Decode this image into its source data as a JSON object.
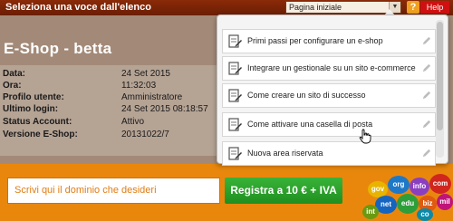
{
  "topbar": {
    "title": "Seleziona una voce dall'elenco",
    "page_select_value": "Pagina iniziale",
    "help_q": "?",
    "help_label": "Help"
  },
  "shop": {
    "title": "E-Shop - betta"
  },
  "info": {
    "rows": [
      {
        "label": "Data:",
        "value": "24 Set 2015"
      },
      {
        "label": "Ora:",
        "value": "11:32:03"
      },
      {
        "label": "Profilo utente:",
        "value": "Amministratore"
      },
      {
        "label": "Ultimo login:",
        "value": "24 Set 2015 08:18:57"
      },
      {
        "label": "Status Account:",
        "value": "Attivo"
      },
      {
        "label": "Versione E-Shop:",
        "value": "20131022/7"
      }
    ]
  },
  "domain": {
    "placeholder": "Scrivi qui il dominio che desideri",
    "register_label": "Registra a 10 € + IVA",
    "tlds": [
      "gov",
      "org",
      "info",
      "com",
      "net",
      "edu",
      "biz",
      "mil",
      "int",
      "co"
    ]
  },
  "menu": {
    "items": [
      {
        "label": "Primi passi per configurare un e-shop"
      },
      {
        "label": "Integrare un gestionale su un sito e-commerce"
      },
      {
        "label": "Come creare un sito di successo"
      },
      {
        "label": "Come attivare una casella di posta"
      },
      {
        "label": "Nuova area riservata"
      }
    ]
  },
  "colors": {
    "topbar": "#7a2206",
    "accent_orange": "#e9870d",
    "register_green": "#2aa22a",
    "help_red": "#d01010"
  }
}
